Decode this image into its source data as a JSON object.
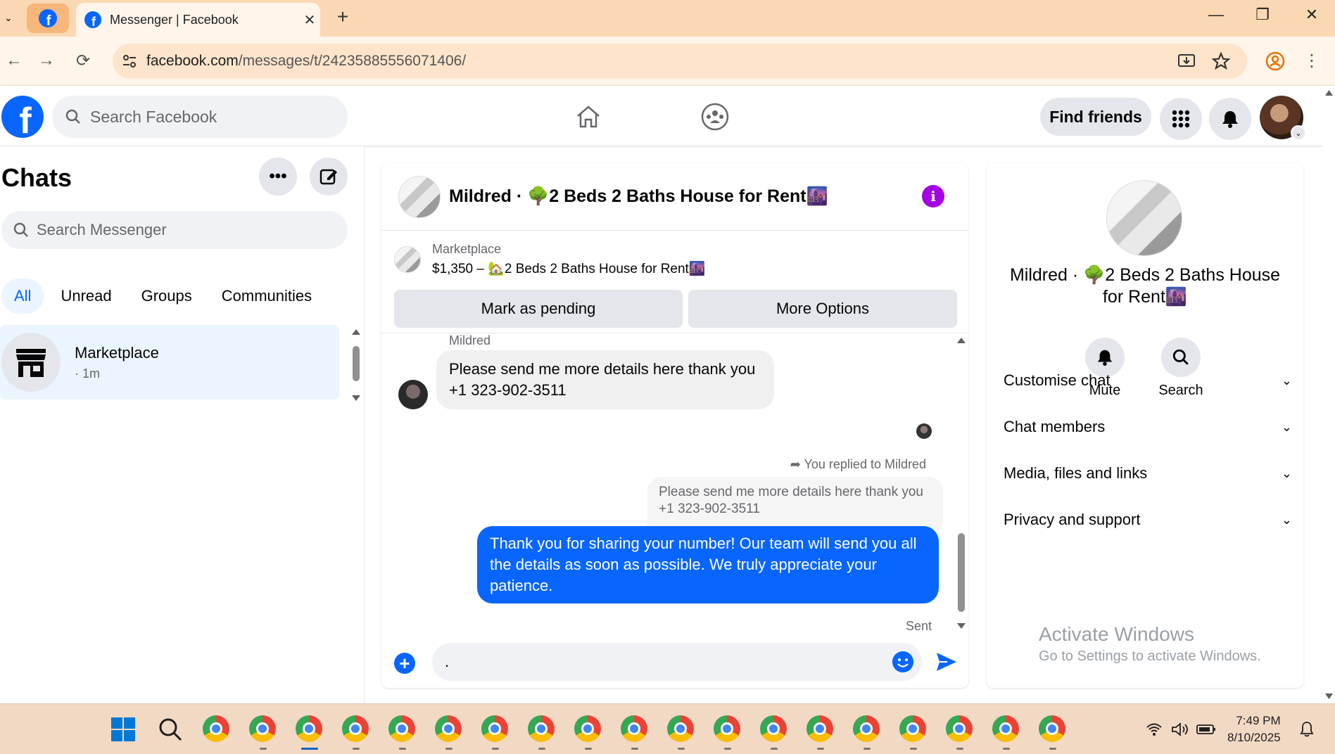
{
  "browser": {
    "tab_title": "Messenger | Facebook",
    "new_tab_label": "+",
    "url_host": "facebook.com",
    "url_path": "/messages/t/24235885556071406/"
  },
  "header": {
    "search_placeholder": "Search Facebook",
    "find_friends_label": "Find friends"
  },
  "sidebar": {
    "title": "Chats",
    "search_placeholder": "Search Messenger",
    "filters": [
      {
        "label": "All",
        "active": true
      },
      {
        "label": "Unread",
        "active": false
      },
      {
        "label": "Groups",
        "active": false
      },
      {
        "label": "Communities",
        "active": false
      }
    ],
    "chats": [
      {
        "name": "Marketplace",
        "time": "· 1m"
      }
    ]
  },
  "conversation": {
    "title": "Mildred · 🌳2 Beds 2 Baths House for Rent🌆",
    "marketplace_label": "Marketplace",
    "listing": "$1,350 – 🏡2 Beds 2 Baths House for Rent🌆",
    "mark_pending_label": "Mark as pending",
    "more_options_label": "More Options",
    "sender_name": "Mildred",
    "incoming_message": "Please send me more details here thank you +1 323-902-3511",
    "reply_note": "You replied to Mildred",
    "quoted_message": "Please send me more details here thank you +1 323-902-3511",
    "outgoing_message": "Thank you for sharing your number!  Our team will send you all the details as soon as possible. We truly appreciate your patience.",
    "status": "Sent",
    "composer_value": "."
  },
  "details_panel": {
    "title": "Mildred · 🌳2 Beds 2 Baths House for Rent🌆",
    "actions": [
      {
        "label": "Mute",
        "icon": "bell-icon"
      },
      {
        "label": "Search",
        "icon": "search-icon"
      }
    ],
    "sections": [
      {
        "label": "Customise chat"
      },
      {
        "label": "Chat members"
      },
      {
        "label": "Media, files and links"
      },
      {
        "label": "Privacy and support"
      }
    ]
  },
  "watermark": {
    "line1": "Activate Windows",
    "line2": "Go to Settings to activate Windows."
  },
  "taskbar": {
    "time": "7:49 PM",
    "date": "8/10/2025"
  },
  "colors": {
    "accent": "#0866ff",
    "info_purple": "#a400e6",
    "selected_chat_bg": "#ebf5ff",
    "browser_tabbar": "#fbd8b4"
  }
}
